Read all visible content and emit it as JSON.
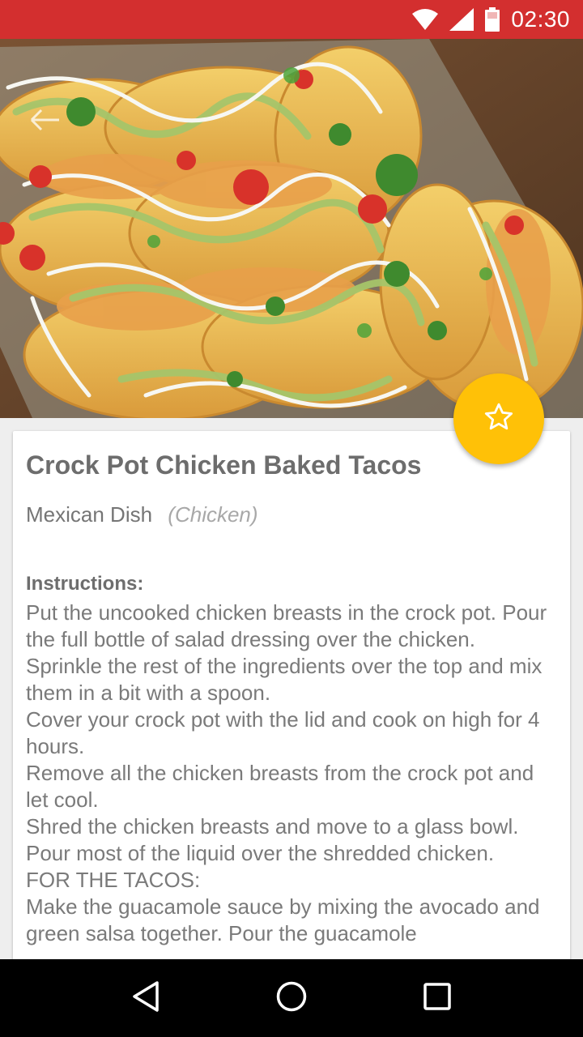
{
  "status_bar": {
    "time": "02:30",
    "background": "#d32f2f",
    "icons": [
      "wifi-icon",
      "cellular-signal-icon",
      "battery-icon"
    ]
  },
  "hero": {
    "alt": "Crock Pot Chicken Baked Tacos",
    "back_icon": "arrow-back-icon"
  },
  "fab": {
    "icon": "star-outline-icon",
    "color": "#ffc107"
  },
  "recipe": {
    "title": "Crock Pot Chicken Baked Tacos",
    "category": "Mexican Dish",
    "subcategory": "(Chicken)",
    "instructions_heading": "Instructions:",
    "instructions": "Put the uncooked chicken breasts in the crock pot. Pour the full bottle of salad dressing over the chicken. Sprinkle the rest of the ingredients over the top and mix them in a bit with a spoon.\nCover your crock pot with the lid and cook on high for 4 hours.\nRemove all the chicken breasts from the crock pot and let cool.\nShred the chicken breasts and move to a glass bowl.\nPour most of the liquid over the shredded chicken.\nFOR THE TACOS:\nMake the guacamole sauce by mixing the avocado and green salsa together. Pour the guacamole"
  },
  "nav_bar": {
    "buttons": [
      "back-triangle-icon",
      "home-circle-icon",
      "recents-square-icon"
    ]
  }
}
